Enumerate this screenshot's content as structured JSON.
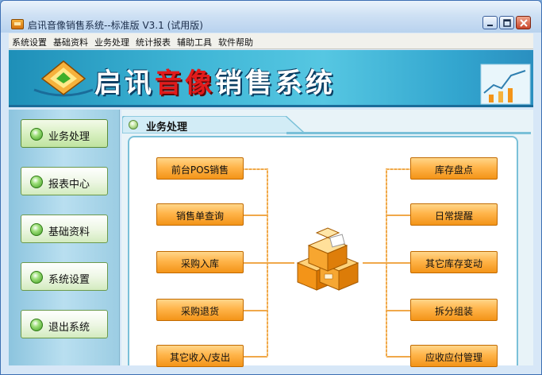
{
  "window": {
    "title": "启讯音像销售系统--标准版 V3.1 (试用版)"
  },
  "menu": [
    "系统设置",
    "基础资料",
    "业务处理",
    "统计报表",
    "辅助工具",
    "软件帮助"
  ],
  "banner": {
    "title_part1": "启讯",
    "title_part2": "音像",
    "title_part3": "销售系统"
  },
  "sidebar": {
    "items": [
      {
        "label": "业务处理",
        "active": true
      },
      {
        "label": "报表中心"
      },
      {
        "label": "基础资料"
      },
      {
        "label": "系统设置"
      },
      {
        "label": "退出系统"
      }
    ]
  },
  "panel": {
    "title": "业务处理"
  },
  "actions": {
    "left": [
      "前台POS销售",
      "销售单查询",
      "采购入库",
      "采购退货",
      "其它收入/支出"
    ],
    "right": [
      "库存盘点",
      "日常提醒",
      "其它库存变动",
      "拆分组装",
      "应收应付管理"
    ]
  },
  "colors": {
    "accent": "#f39418",
    "banner": "#3fb6d6",
    "nav_green": "#3e9b1f"
  }
}
